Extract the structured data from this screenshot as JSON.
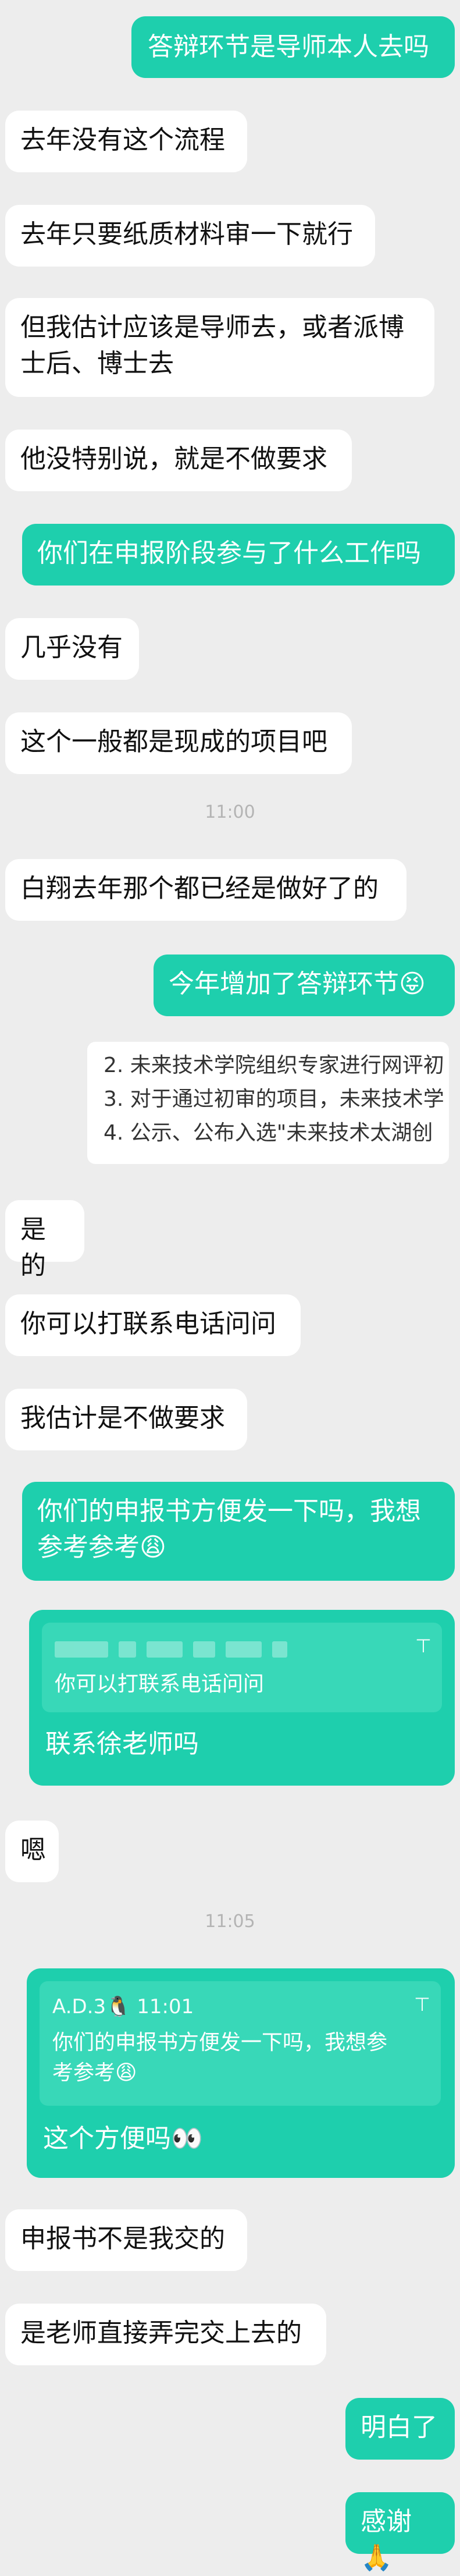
{
  "messages": {
    "m1": "答辩环节是导师本人去吗",
    "m2": "去年没有这个流程",
    "m3": "去年只要纸质材料审一下就行",
    "m4a": "但我估计应该是导师去，或者派博",
    "m4b": "士后、博士去",
    "m5": "他没特别说，就是不做要求",
    "m6": "你们在申报阶段参与了什么工作吗",
    "m7": "几乎没有",
    "m8": "这个一般都是现成的项目吧",
    "m9": "白翔去年那个都已经是做好了的",
    "m10": "今年增加了答辩环节😝",
    "m11": "是的",
    "m12": "你可以打联系电话问问",
    "m13": "我估计是不做要求",
    "m14a": "你们的申报书方便发一下吗，我想",
    "m14b": "参考参考😩",
    "m15": "联系徐老师吗",
    "m16": "嗯",
    "m17": "这个方便吗👀",
    "m18": "申报书不是我交的",
    "m19": "是老师直接弄完交上去的",
    "m20": "明白了",
    "m21": "感谢🙏"
  },
  "times": {
    "t1": "11:00",
    "t2": "11:05"
  },
  "attachment": {
    "line1": "2.  未来技术学院组织专家进行网评初",
    "line2": "3.  对于通过初审的项目，未来技术学",
    "line3": "4.  公示、公布入选\"未来技术太湖创"
  },
  "quote1": {
    "text": "你可以打联系电话问问"
  },
  "quote2": {
    "author": "A.D.3🐧 11:01",
    "line1": "你们的申报书方便发一下吗，我想参",
    "line2": "考参考😩"
  },
  "icons": {
    "quote_arrow": "⊤"
  },
  "colors": {
    "green": "#1ecfad",
    "background": "#ededed"
  }
}
